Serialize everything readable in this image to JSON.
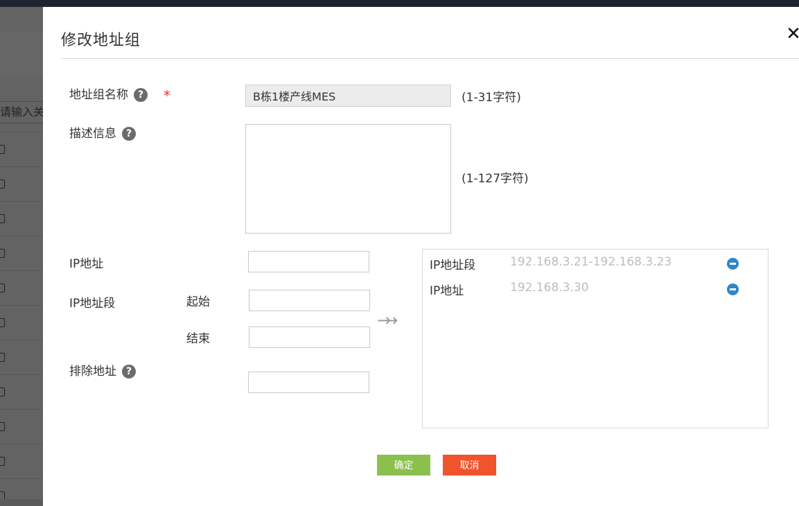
{
  "background": {
    "search_placeholder": "请输入关"
  },
  "dialog": {
    "title": "修改地址组",
    "close_glyph": "✕",
    "help_glyph": "?",
    "required_mark": "*",
    "fields": {
      "name": {
        "label": "地址组名称",
        "value": "B栋1楼产线MES",
        "hint": "(1-31字符)"
      },
      "description": {
        "label": "描述信息",
        "value": "",
        "hint": "(1-127字符)"
      },
      "ip": {
        "label": "IP地址",
        "value": ""
      },
      "ip_range": {
        "label": "IP地址段",
        "start_label": "起始",
        "end_label": "结束",
        "start_value": "",
        "end_value": ""
      },
      "exclude": {
        "label": "排除地址",
        "value": ""
      }
    },
    "add_arrow": "→→",
    "list": [
      {
        "type": "IP地址段",
        "value": "192.168.3.21-192.168.3.23"
      },
      {
        "type": "IP地址",
        "value": "192.168.3.30"
      }
    ],
    "buttons": {
      "ok": "确定",
      "cancel": "取消"
    },
    "colors": {
      "ok": "#8bc04f",
      "cancel": "#f1532d",
      "required": "#e8372c",
      "remove_icon": "#2f86c8"
    }
  }
}
